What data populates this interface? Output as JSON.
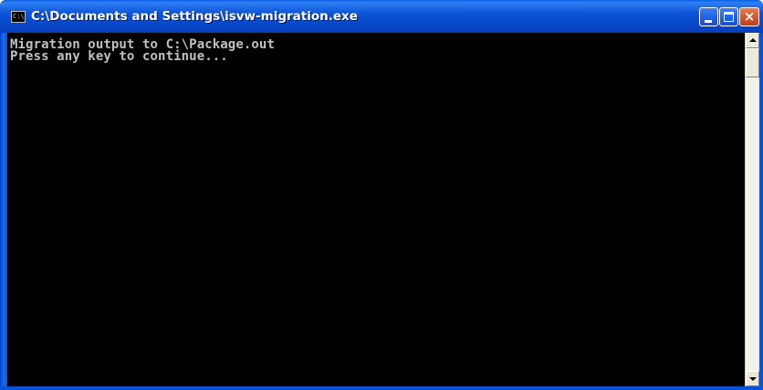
{
  "window": {
    "title": "C:\\Documents and Settings\\isvw-migration.exe",
    "icon": "console-icon",
    "icon_glyph": "C:\\"
  },
  "controls": {
    "minimize_icon": "minimize-icon",
    "maximize_icon": "maximize-icon",
    "close_icon": "close-icon",
    "close_glyph": "×"
  },
  "console": {
    "lines": [
      "Migration output to C:\\Package.out",
      "Press any key to continue..."
    ],
    "background": "#000000",
    "text_color": "#c0c0c0"
  },
  "scrollbar": {
    "up_icon": "arrow-up-icon",
    "down_icon": "arrow-down-icon"
  },
  "theme": {
    "titlebar_color": "#0a5fe6",
    "close_button_color": "#d3502a"
  }
}
